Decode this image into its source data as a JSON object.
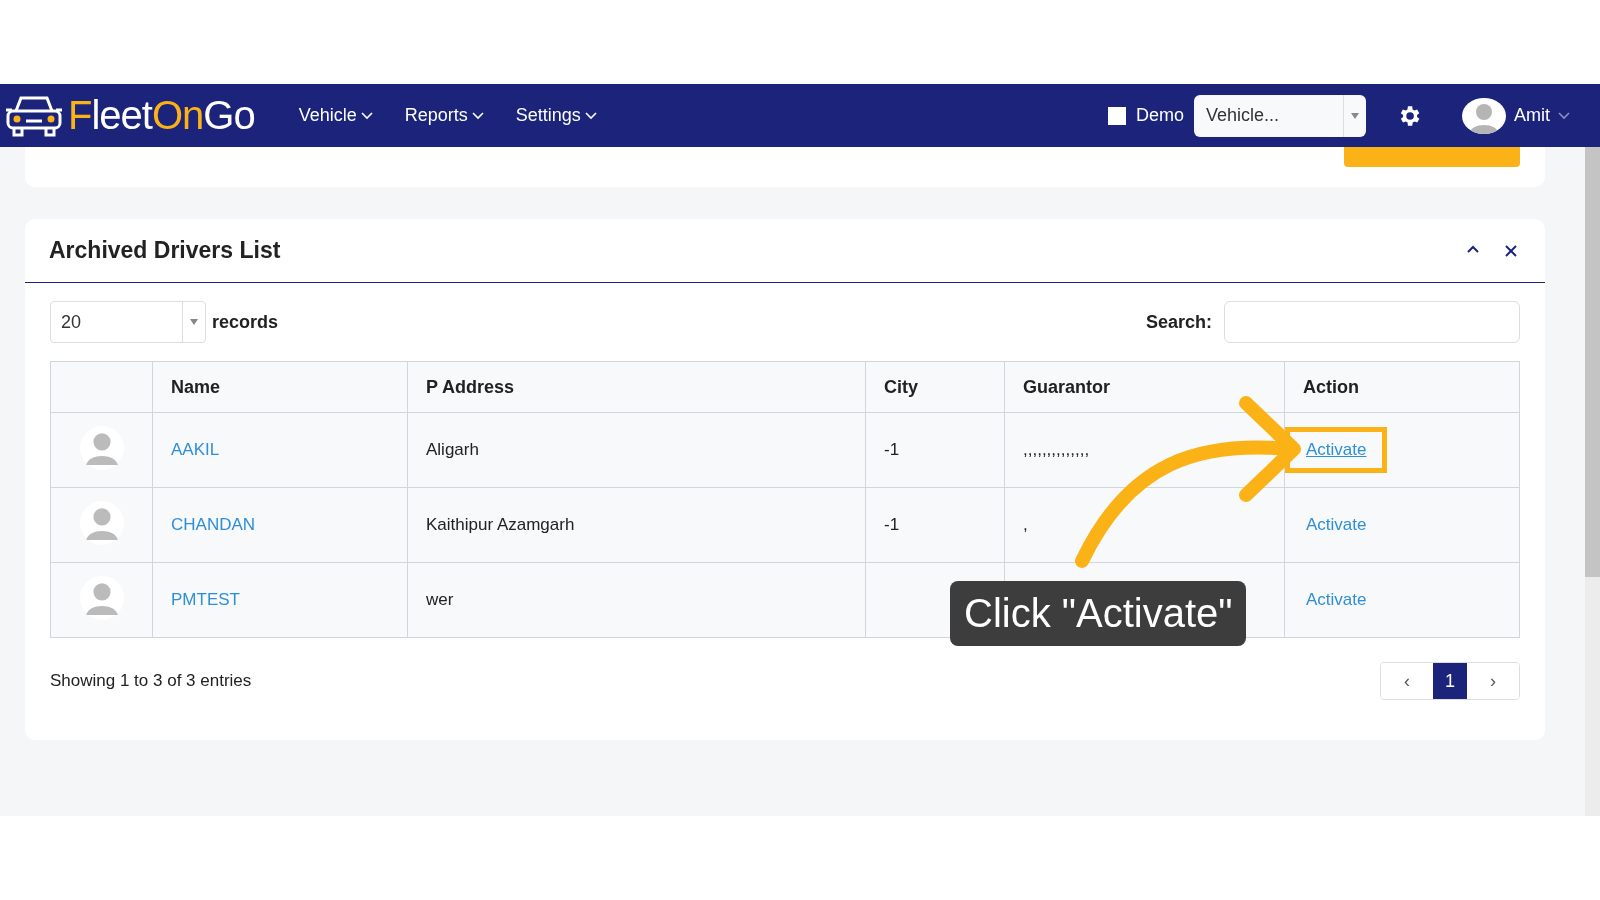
{
  "navbar": {
    "logo": [
      {
        "text": "F",
        "accent": true
      },
      {
        "text": "leet",
        "accent": false
      },
      {
        "text": "On",
        "accent": true
      },
      {
        "text": "Go",
        "accent": false
      }
    ],
    "menu": [
      {
        "label": "Vehicle"
      },
      {
        "label": "Reports"
      },
      {
        "label": "Settings"
      }
    ],
    "demo": {
      "label": "Demo",
      "checked": false
    },
    "vehicle_select": {
      "value": "Vehicle..."
    },
    "user": {
      "name": "Amit"
    }
  },
  "panel": {
    "title": "Archived Drivers List",
    "page_size": {
      "value": "20",
      "label": "records"
    },
    "search": {
      "label": "Search:"
    },
    "table": {
      "columns": [
        "Name",
        "P Address",
        "City",
        "Guarantor",
        "Action"
      ],
      "rows": [
        {
          "name": "AAKIL",
          "address": "Aligarh",
          "city": "-1",
          "guarantor": ",,,,,,,,,,,,,,",
          "action": "Activate",
          "highlighted": true
        },
        {
          "name": "CHANDAN",
          "address": "Kaithipur Azamgarh",
          "city": "-1",
          "guarantor": ",",
          "action": "Activate",
          "highlighted": false
        },
        {
          "name": "PMTEST",
          "address": "wer",
          "action": "Activate",
          "highlighted": false
        }
      ]
    },
    "info": "Showing 1 to 3 of 3 entries",
    "pagination": {
      "prev": "‹",
      "next": "›",
      "pages": [
        {
          "label": "1",
          "selected": true
        }
      ]
    }
  },
  "tutorial": {
    "tooltip": "Click \"Activate\""
  }
}
